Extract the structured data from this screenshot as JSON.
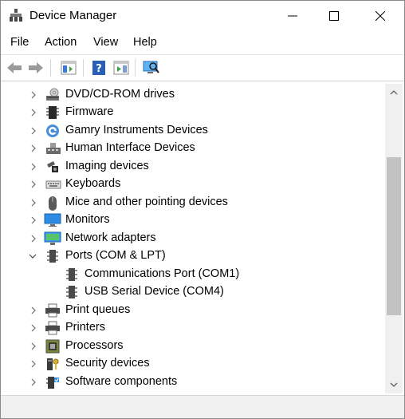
{
  "window": {
    "title": "Device Manager"
  },
  "menu": {
    "file": "File",
    "action": "Action",
    "view": "View",
    "help": "Help"
  },
  "toolbar": {
    "buttons": [
      "back-arrow-icon",
      "forward-arrow-icon",
      "properties-icon",
      "help-icon",
      "update-driver-icon",
      "scan-hardware-icon"
    ]
  },
  "tree": {
    "items": [
      {
        "label": "DVD/CD-ROM drives",
        "icon": "dvd-drive-icon",
        "expanded": false
      },
      {
        "label": "Firmware",
        "icon": "firmware-chip-icon",
        "expanded": false
      },
      {
        "label": "Gamry Instruments Devices",
        "icon": "gamry-logo-icon",
        "expanded": false
      },
      {
        "label": "Human Interface Devices",
        "icon": "hid-icon",
        "expanded": false
      },
      {
        "label": "Imaging devices",
        "icon": "camera-icon",
        "expanded": false
      },
      {
        "label": "Keyboards",
        "icon": "keyboard-icon",
        "expanded": false
      },
      {
        "label": "Mice and other pointing devices",
        "icon": "mouse-icon",
        "expanded": false
      },
      {
        "label": "Monitors",
        "icon": "monitor-icon",
        "expanded": false
      },
      {
        "label": "Network adapters",
        "icon": "network-adapter-icon",
        "expanded": false
      },
      {
        "label": "Ports (COM & LPT)",
        "icon": "port-icon",
        "expanded": true
      },
      {
        "label": "Communications Port (COM1)",
        "icon": "port-icon",
        "child": true
      },
      {
        "label": "USB Serial Device (COM4)",
        "icon": "port-icon",
        "child": true
      },
      {
        "label": "Print queues",
        "icon": "printer-icon",
        "expanded": false
      },
      {
        "label": "Printers",
        "icon": "printer-icon",
        "expanded": false
      },
      {
        "label": "Processors",
        "icon": "processor-icon",
        "expanded": false
      },
      {
        "label": "Security devices",
        "icon": "security-device-icon",
        "expanded": false
      },
      {
        "label": "Software components",
        "icon": "software-component-icon",
        "expanded": false
      }
    ]
  },
  "colors": {
    "accent": "#1e6fd9",
    "scroll_thumb": "#c2c2c2",
    "status_bar": "#f0f0f0"
  }
}
